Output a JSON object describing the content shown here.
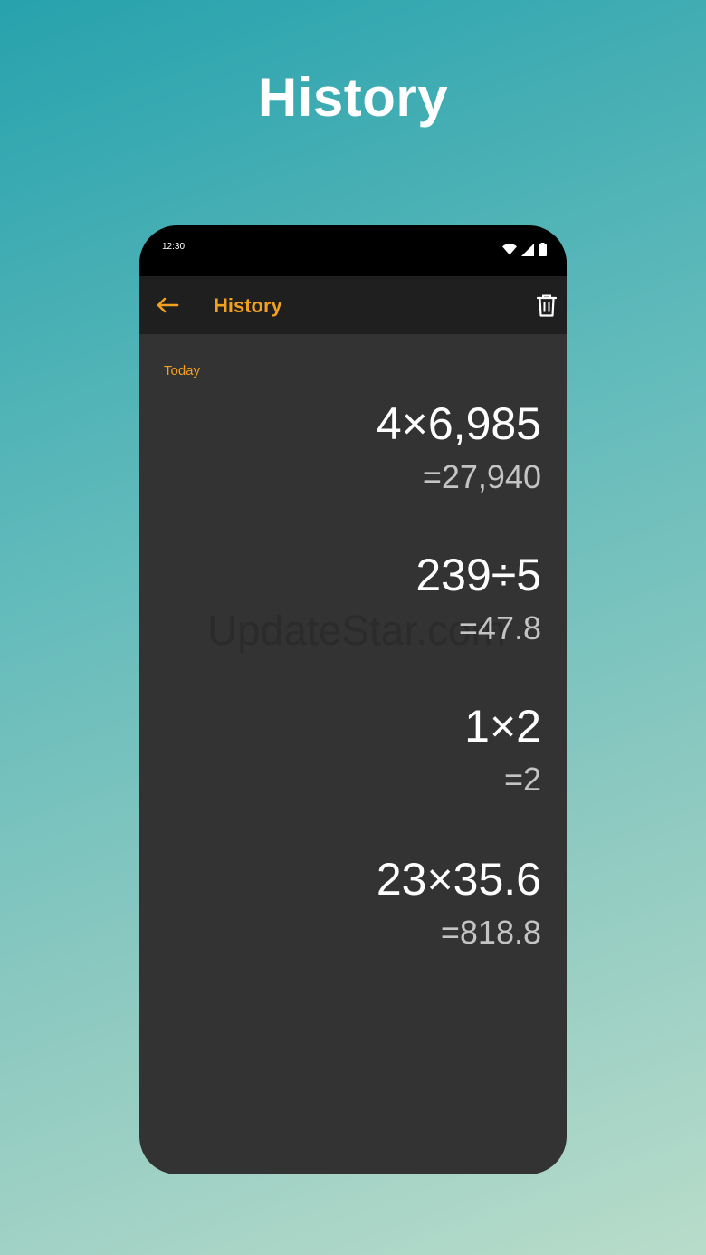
{
  "promo": {
    "title": "History"
  },
  "status_bar": {
    "time": "12:30",
    "icons": [
      "wifi-icon",
      "cell-signal-icon",
      "battery-icon"
    ]
  },
  "app_bar": {
    "title": "History",
    "back_icon": "arrow-left-icon",
    "delete_icon": "trash-icon",
    "accent_color": "#f1a020"
  },
  "history": {
    "section_label": "Today",
    "entries": [
      {
        "expression": "4×6,985",
        "result": "=27,940"
      },
      {
        "expression": "239÷5",
        "result": "=47.8"
      },
      {
        "expression": "1×2",
        "result": "=2"
      }
    ],
    "current": {
      "expression": "23×35.6",
      "result": "=818.8"
    }
  },
  "watermark": "UpdateStar.com"
}
